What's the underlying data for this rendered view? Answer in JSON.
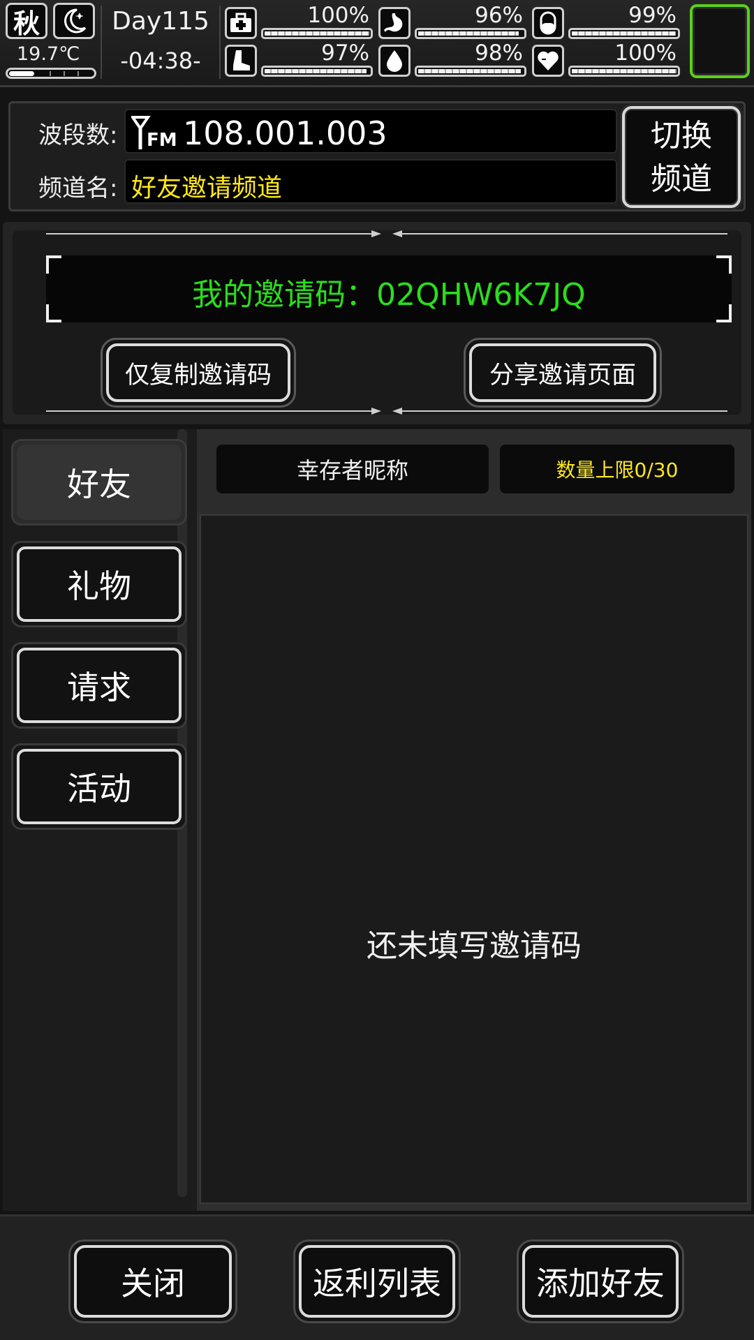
{
  "status": {
    "season": "秋",
    "moon_icon": "crescent-moon-icon",
    "temperature": "19.7℃",
    "day": "Day115",
    "time": "-04:38-",
    "thermo_level": 0.3,
    "stats": [
      {
        "icon": "medkit-icon",
        "value": "100%",
        "level": 1.0
      },
      {
        "icon": "stomach-icon",
        "value": "96%",
        "level": 0.96
      },
      {
        "icon": "pill-icon",
        "value": "99%",
        "level": 0.99
      },
      {
        "icon": "boot-icon",
        "value": "97%",
        "level": 0.97
      },
      {
        "icon": "water-drop-icon",
        "value": "98%",
        "level": 0.98
      },
      {
        "icon": "heart-icon",
        "value": "100%",
        "level": 1.0
      }
    ],
    "accent_color": "#5ccf1a"
  },
  "radio": {
    "band_label": "波段数:",
    "frequency_prefix": "FM",
    "frequency": "108.001.003",
    "channel_label": "频道名:",
    "channel_name": "好友邀请频道",
    "switch_line1": "切换",
    "switch_line2": "频道"
  },
  "invite": {
    "code_text": "我的邀请码：02QHW6K7JQ",
    "copy_button": "仅复制邀请码",
    "share_button": "分享邀请页面",
    "code_color": "#2bdd1d"
  },
  "tabs": [
    {
      "label": "好友",
      "active": true
    },
    {
      "label": "礼物",
      "active": false
    },
    {
      "label": "请求",
      "active": false
    },
    {
      "label": "活动",
      "active": false
    }
  ],
  "list": {
    "nickname_header": "幸存者昵称",
    "limit_header": "数量上限0/30",
    "empty_message": "还未填写邀请码"
  },
  "footer": {
    "close": "关闭",
    "rebate_list": "返利列表",
    "add_friend": "添加好友"
  }
}
